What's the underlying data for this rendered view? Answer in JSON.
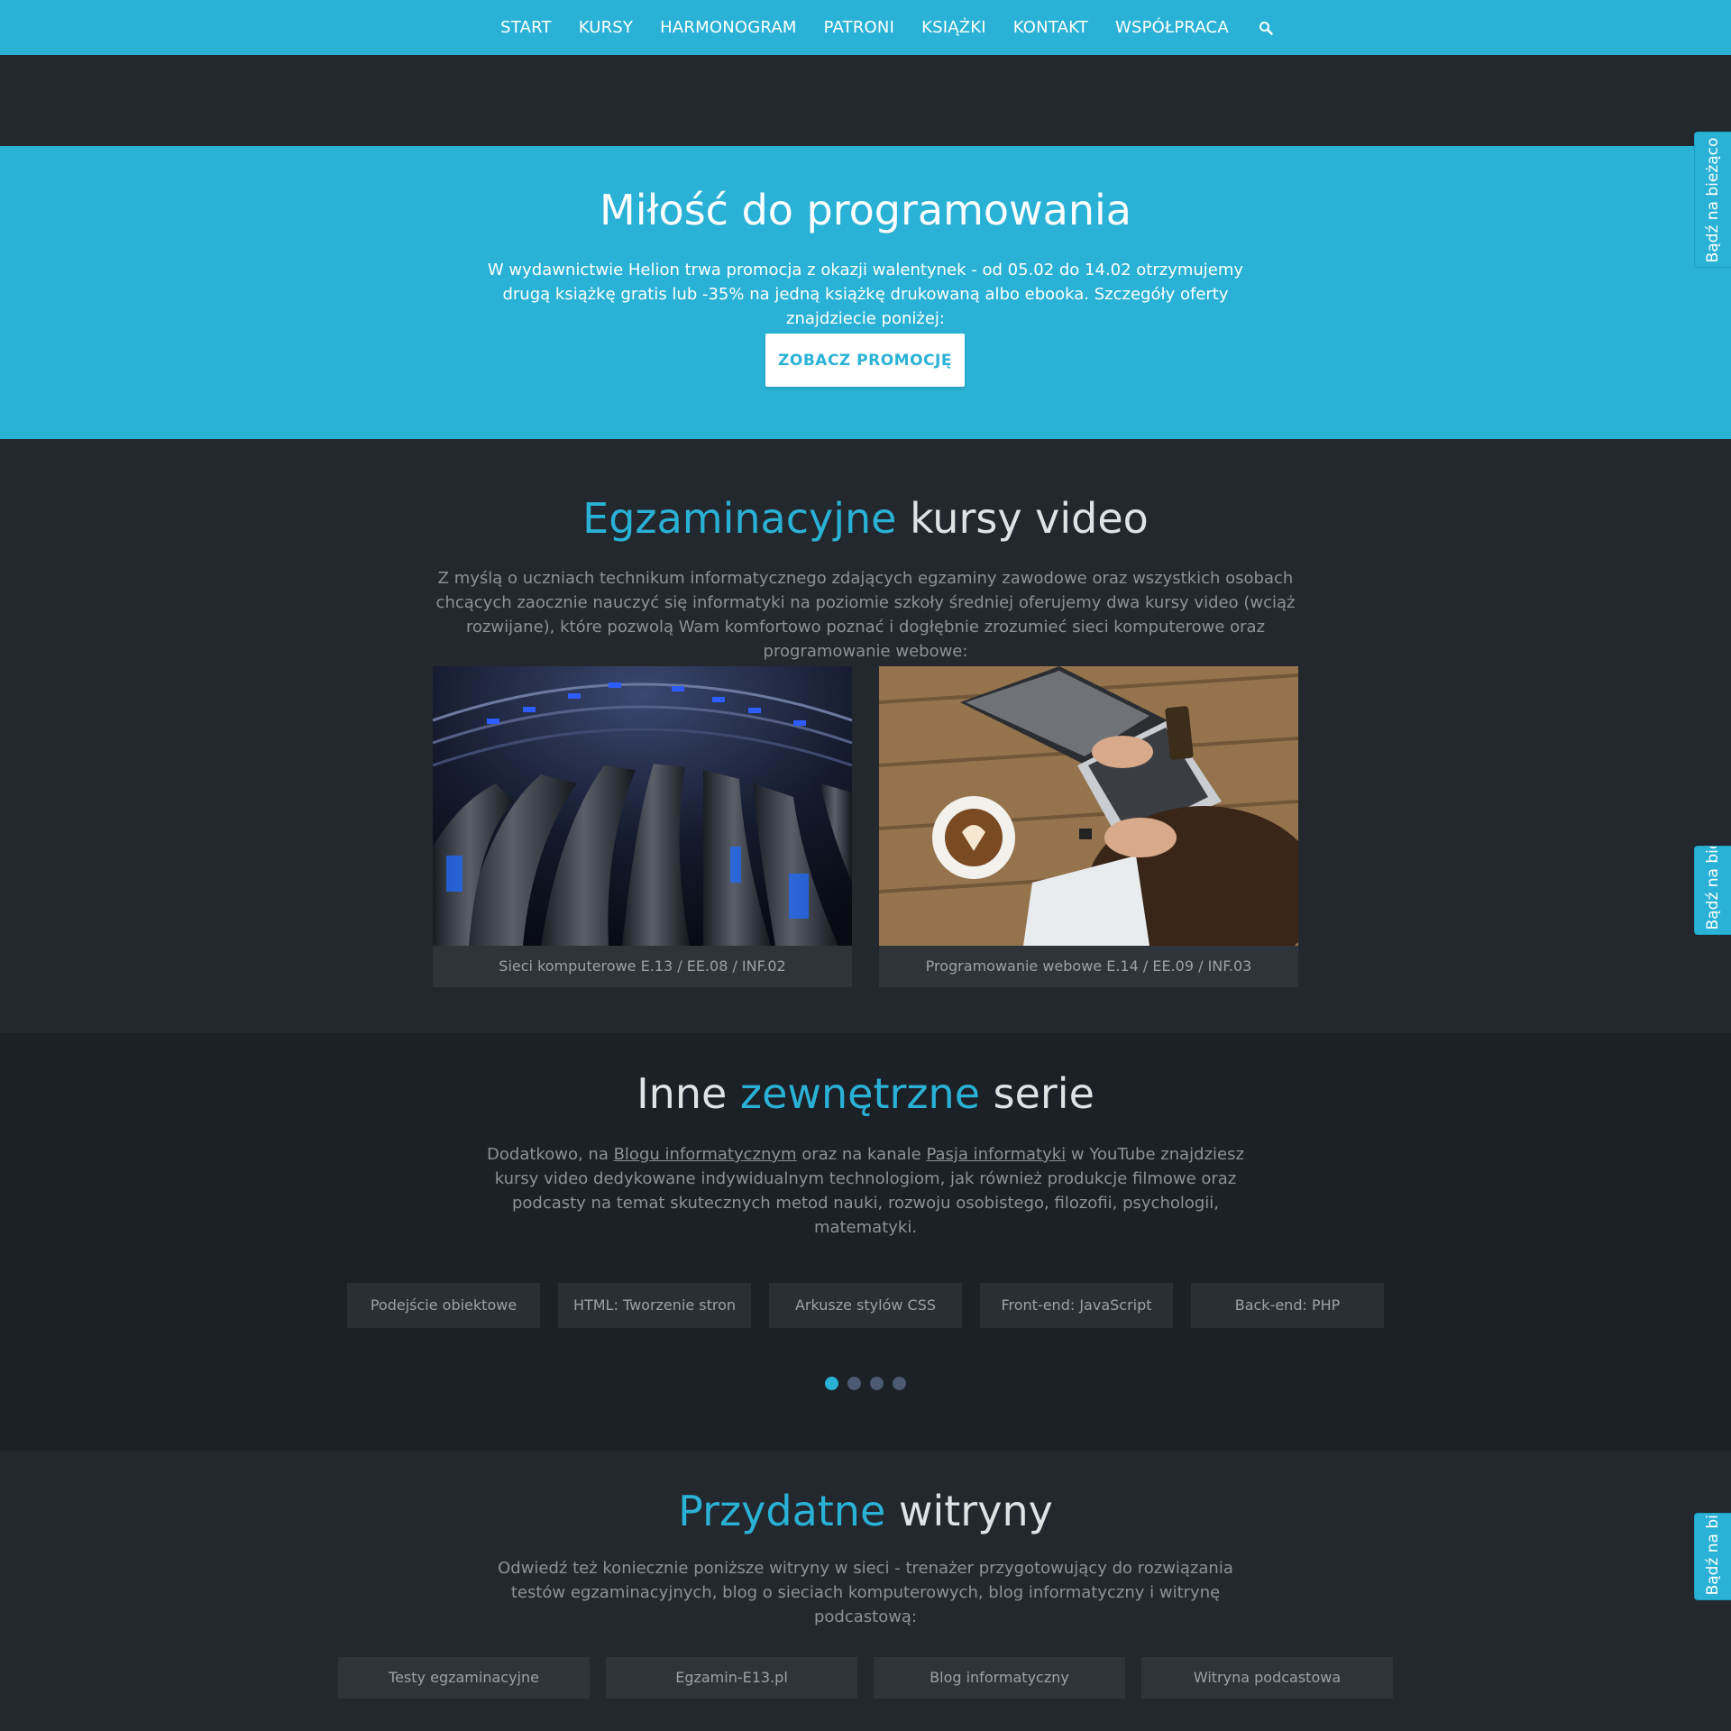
{
  "nav": {
    "items": [
      "START",
      "KURSY",
      "HARMONOGRAM",
      "PATRONI",
      "KSIĄŻKI",
      "KONTAKT",
      "WSPÓŁPRACA"
    ],
    "search_icon": "search-icon"
  },
  "promo": {
    "title": "Miłość do programowania",
    "text": "W wydawnictwie Helion trwa promocja z okazji walentynek - od 05.02 do 14.02 otrzymujemy drugą książkę gratis lub -35% na jedną książkę drukowaną albo ebooka. Szczegóły oferty znajdziecie poniżej:",
    "button": "ZOBACZ PROMOCJĘ"
  },
  "courses": {
    "title_accent": "Egzaminacyjne",
    "title_rest": " kursy video",
    "text": "Z myślą o uczniach technikum informatycznego zdających egzaminy zawodowe oraz wszystkich osobach chcących zaocznie nauczyć się informatyki na poziomie szkoły średniej oferujemy dwa kursy video (wciąż rozwijane), które pozwolą Wam komfortowo poznać i dogłębnie zrozumieć sieci komputerowe oraz programowanie webowe:",
    "cards": [
      {
        "caption": "Sieci komputerowe E.13 / EE.08 / INF.02"
      },
      {
        "caption": "Programowanie webowe E.14 / EE.09 / INF.03"
      }
    ]
  },
  "series": {
    "title_start": "Inne ",
    "title_accent": "zewnętrzne",
    "title_end": " serie",
    "text_1": "Dodatkowo, na ",
    "link_1": "Blogu informatycznym",
    "text_2": " oraz na kanale ",
    "link_2": "Pasja informatyki",
    "text_3": " w YouTube znajdziesz kursy video dedykowane indywidualnym technologiom, jak również produkcje filmowe oraz podcasty na temat skutecznych metod nauki, rozwoju osobistego, filozofii, psychologii, matematyki.",
    "buttons": [
      "Podejście obiektowe",
      "HTML: Tworzenie stron",
      "Arkusze stylów CSS",
      "Front-end: JavaScript",
      "Back-end: PHP"
    ],
    "carousel_active": 1,
    "carousel_count": 4
  },
  "sites": {
    "title_accent": "Przydatne",
    "title_rest": " witryny",
    "text": "Odwiedź też koniecznie poniższe witryny w sieci - trenażer przygotowujący do rozwiązania testów egzaminacyjnych, blog o sieciach komputerowych, blog informatyczny i witrynę podcastową:",
    "buttons": [
      "Testy egzaminacyjne",
      "Egzamin-E13.pl",
      "Blog informatyczny",
      "Witryna podcastowa"
    ]
  },
  "side_tab": {
    "label": "Bądź na bieżąco"
  },
  "colors": {
    "accent": "#2ab2d6",
    "dark_bg": "#23282e",
    "darker_bg": "#1c2027"
  }
}
